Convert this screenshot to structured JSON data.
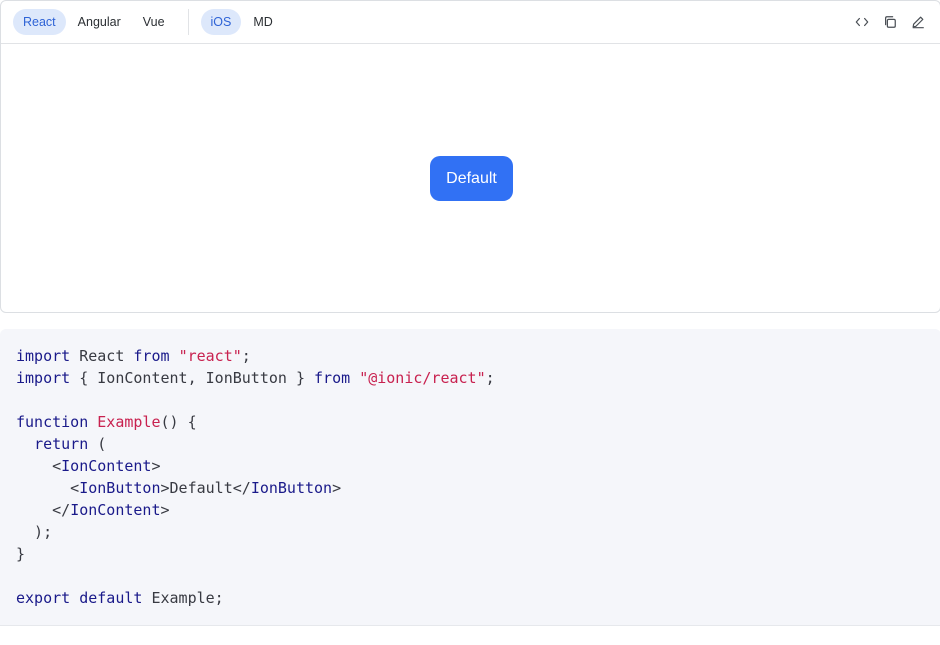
{
  "toolbar": {
    "frameworks": [
      {
        "label": "React",
        "active": true
      },
      {
        "label": "Angular",
        "active": false
      },
      {
        "label": "Vue",
        "active": false
      }
    ],
    "modes": [
      {
        "label": "iOS",
        "active": true
      },
      {
        "label": "MD",
        "active": false
      }
    ],
    "actions": [
      "code-icon",
      "copy-icon",
      "edit-icon"
    ]
  },
  "preview": {
    "button_label": "Default",
    "button_color": "#3171f4"
  },
  "code": {
    "lines": [
      [
        [
          "kw",
          "import"
        ],
        [
          "plain",
          " React "
        ],
        [
          "kw",
          "from"
        ],
        [
          "plain",
          " "
        ],
        [
          "str",
          "\"react\""
        ],
        [
          "plain",
          ";"
        ]
      ],
      [
        [
          "kw",
          "import"
        ],
        [
          "plain",
          " { IonContent, IonButton } "
        ],
        [
          "kw",
          "from"
        ],
        [
          "plain",
          " "
        ],
        [
          "str",
          "\"@ionic/react\""
        ],
        [
          "plain",
          ";"
        ]
      ],
      [],
      [
        [
          "kw",
          "function"
        ],
        [
          "plain",
          " "
        ],
        [
          "fn",
          "Example"
        ],
        [
          "plain",
          "() {"
        ]
      ],
      [
        [
          "plain",
          "  "
        ],
        [
          "kw",
          "return"
        ],
        [
          "plain",
          " ("
        ]
      ],
      [
        [
          "plain",
          "    <"
        ],
        [
          "tag",
          "IonContent"
        ],
        [
          "plain",
          ">"
        ]
      ],
      [
        [
          "plain",
          "      <"
        ],
        [
          "tag",
          "IonButton"
        ],
        [
          "plain",
          ">Default</"
        ],
        [
          "tag",
          "IonButton"
        ],
        [
          "plain",
          ">"
        ]
      ],
      [
        [
          "plain",
          "    </"
        ],
        [
          "tag",
          "IonContent"
        ],
        [
          "plain",
          ">"
        ]
      ],
      [
        [
          "plain",
          "  );"
        ]
      ],
      [
        [
          "plain",
          "}"
        ]
      ],
      [],
      [
        [
          "kw",
          "export"
        ],
        [
          "plain",
          " "
        ],
        [
          "kw",
          "default"
        ],
        [
          "plain",
          " Example;"
        ]
      ]
    ]
  }
}
